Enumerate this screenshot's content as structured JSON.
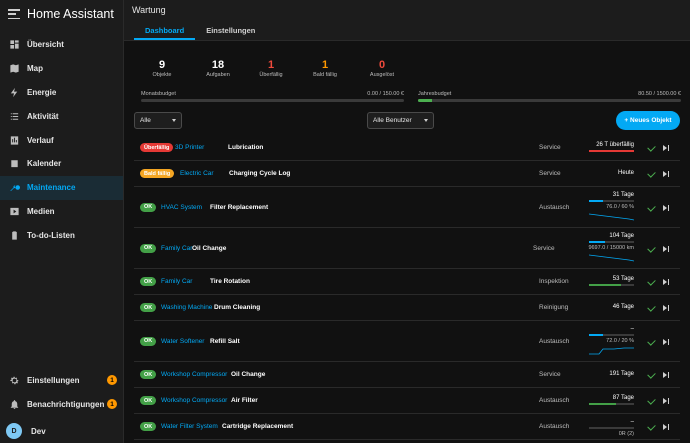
{
  "app": {
    "title": "Home Assistant"
  },
  "sidebar": {
    "items": [
      {
        "label": "Übersicht",
        "icon": "view-dashboard-icon"
      },
      {
        "label": "Map",
        "icon": "map-icon"
      },
      {
        "label": "Energie",
        "icon": "lightning-bolt-icon"
      },
      {
        "label": "Aktivität",
        "icon": "format-list-bulleted-icon"
      },
      {
        "label": "Verlauf",
        "icon": "chart-box-icon"
      },
      {
        "label": "Kalender",
        "icon": "calendar-icon"
      },
      {
        "label": "Maintenance",
        "icon": "wrench-clock-icon",
        "active": true
      },
      {
        "label": "Medien",
        "icon": "play-box-icon"
      },
      {
        "label": "To-do-Listen",
        "icon": "clipboard-list-icon"
      }
    ],
    "settings": {
      "label": "Einstellungen",
      "badge": "1"
    },
    "notifications": {
      "label": "Benachrichtigungen",
      "badge": "1"
    },
    "user": {
      "initial": "D",
      "name": "Dev"
    }
  },
  "header": {
    "title": "Wartung"
  },
  "tabs": [
    {
      "label": "Dashboard",
      "active": true
    },
    {
      "label": "Einstellungen"
    }
  ],
  "stats": [
    {
      "value": "9",
      "label": "Objekte"
    },
    {
      "value": "18",
      "label": "Aufgaben"
    },
    {
      "value": "1",
      "label": "Überfällig",
      "color": "#ef4a3c"
    },
    {
      "value": "1",
      "label": "Bald fällig",
      "color": "#ff9800"
    },
    {
      "value": "0",
      "label": "Ausgelöst",
      "color": "#ef4a3c"
    }
  ],
  "budgets": {
    "monthly": {
      "label": "Monatsbudget",
      "value": "0.00 / 150.00 €",
      "fraction": 0.0
    },
    "yearly": {
      "label": "Jahresbudget",
      "value": "80.50 / 1500.00 €",
      "fraction": 0.054
    }
  },
  "filters": {
    "object": "Alle",
    "user": "Alle Benutzer",
    "new_button": "+ Neues Objekt"
  },
  "tasks": [
    {
      "status": "Überfällig",
      "status_kind": "bad",
      "object": "3D Printer",
      "task": "Lubrication",
      "type": "Service",
      "due": "26 T überfällig",
      "progress": 1.0,
      "progress_color": "#e53935"
    },
    {
      "status": "Bald fällig",
      "status_kind": "warn",
      "object": "Electric Car",
      "task": "Charging Cycle Log",
      "type": "Service",
      "due": "Heute"
    },
    {
      "status": "OK",
      "status_kind": "ok",
      "object": "HVAC System",
      "task": "Filter Replacement",
      "type": "Austausch",
      "due": "31 Tage",
      "progress": 0.3,
      "progress_color": "#03a9f4",
      "detail": "76.0 / 60 %",
      "spark": true
    },
    {
      "status": "OK",
      "status_kind": "ok",
      "object": "Family Car",
      "task": "Oil Change",
      "type": "Service",
      "due": "104 Tage",
      "progress": 0.35,
      "progress_color": "#03a9f4",
      "detail": "9697.0 / 15000 km",
      "spark": true
    },
    {
      "status": "OK",
      "status_kind": "ok",
      "object": "Family Car",
      "task": "Tire Rotation",
      "type": "Inspektion",
      "due": "53 Tage",
      "progress": 0.7,
      "progress_color": "#43a047"
    },
    {
      "status": "OK",
      "status_kind": "ok",
      "object": "Washing Machine",
      "task": "Drum Cleaning",
      "type": "Reinigung",
      "due": "46 Tage"
    },
    {
      "status": "OK",
      "status_kind": "ok",
      "object": "Water Softener",
      "task": "Refill Salt",
      "type": "Austausch",
      "due": "–",
      "progress": 0.3,
      "progress_color": "#03a9f4",
      "detail": "72.0 / 20 %",
      "spark": true
    },
    {
      "status": "OK",
      "status_kind": "ok",
      "object": "Workshop Compressor",
      "task": "Oil Change",
      "type": "Service",
      "due": "191 Tage"
    },
    {
      "status": "OK",
      "status_kind": "ok",
      "object": "Workshop Compressor",
      "task": "Air Filter",
      "type": "Austausch",
      "due": "87 Tage",
      "progress": 0.6,
      "progress_color": "#43a047"
    },
    {
      "status": "OK",
      "status_kind": "ok",
      "object": "Water Filter System",
      "task": "Cartridge Replacement",
      "type": "Austausch",
      "due": "–",
      "progress": 0.0,
      "progress_color": "#43a047",
      "detail": "0R (2)"
    }
  ]
}
